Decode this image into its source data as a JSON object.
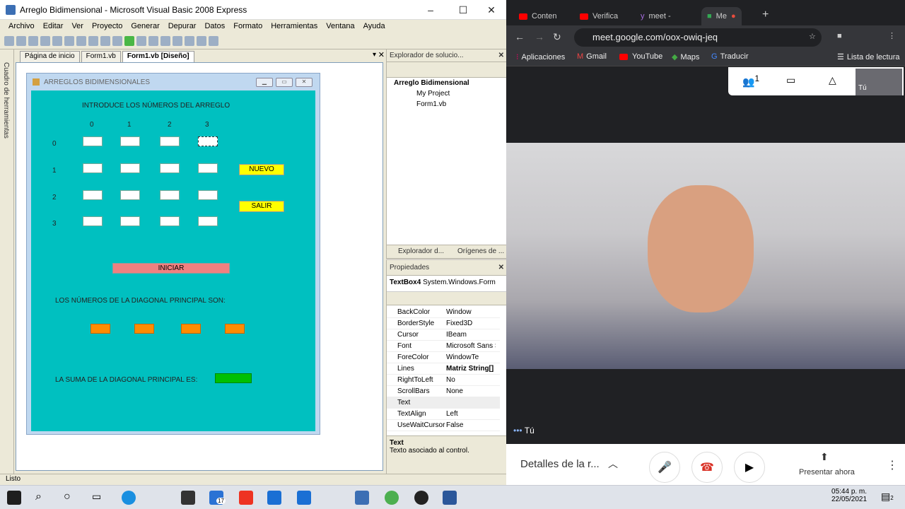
{
  "vb": {
    "window_title": "Arreglo Bidimensional - Microsoft Visual Basic 2008 Express",
    "menu": [
      "Archivo",
      "Editar",
      "Ver",
      "Proyecto",
      "Generar",
      "Depurar",
      "Datos",
      "Formato",
      "Herramientas",
      "Ventana",
      "Ayuda"
    ],
    "toolbox_label": "Cuadro de herramientas",
    "tabs": [
      "Página de inicio",
      "Form1.vb",
      "Form1.vb [Diseño]"
    ],
    "status": "Listo"
  },
  "form": {
    "title": "ARREGLOS BIDIMENSIONALES",
    "intro_label": "INTRODUCE LOS NÚMEROS DEL ARREGLO",
    "col_labels": [
      "0",
      "1",
      "2",
      "3"
    ],
    "row_labels": [
      "0",
      "1",
      "2",
      "3"
    ],
    "nuevo_button": "NUEVO",
    "salir_button": "SALIR",
    "iniciar_button": "INICIAR",
    "diagonal_label": "LOS NÚMEROS DE LA DIAGONAL PRINCIPAL SON:",
    "suma_label": "LA SUMA DE LA DIAGONAL PRINCIPAL ES:"
  },
  "solution_explorer": {
    "header": "Explorador de solucio...",
    "items": [
      "Arreglo Bidimensional",
      "My Project",
      "Form1.vb"
    ],
    "bottom_tabs": [
      "Explorador d...",
      "Orígenes de ..."
    ]
  },
  "properties": {
    "header": "Propiedades",
    "object_name": "TextBox4",
    "object_type": "System.Windows.Form",
    "rows": [
      {
        "name": "BackColor",
        "value": "Window"
      },
      {
        "name": "BorderStyle",
        "value": "Fixed3D"
      },
      {
        "name": "Cursor",
        "value": "IBeam"
      },
      {
        "name": "Font",
        "value": "Microsoft Sans S"
      },
      {
        "name": "ForeColor",
        "value": "WindowTe"
      },
      {
        "name": "Lines",
        "value": "Matriz String[]"
      },
      {
        "name": "RightToLeft",
        "value": "No"
      },
      {
        "name": "ScrollBars",
        "value": "None"
      },
      {
        "name": "Text",
        "value": ""
      },
      {
        "name": "TextAlign",
        "value": "Left"
      },
      {
        "name": "UseWaitCursor",
        "value": "False"
      }
    ],
    "desc_title": "Text",
    "desc_text": "Texto asociado al control."
  },
  "chrome": {
    "tabs": [
      "Conten",
      "Verifica",
      "meet -",
      "Me"
    ],
    "url": "meet.google.com/oox-owiq-jeq",
    "bookmarks": [
      "Aplicaciones",
      "Gmail",
      "YouTube",
      "Maps",
      "Traducir"
    ],
    "reading_list": "Lista de lectura",
    "people_count": "1",
    "self_label": "Tú",
    "self_thumb_label": "Tú",
    "details_label": "Detalles de la r...",
    "present_label": "Presentar ahora"
  },
  "taskbar": {
    "time": "05:44 p. m.",
    "date": "22/05/2021",
    "mail_badge": "17",
    "notif_badge": "2"
  },
  "colors": {
    "form_client": "#00c0c0",
    "nuevo_salir": "#ffff00",
    "iniciar": "#f08080",
    "diagonal_boxes": "#ff8c00",
    "suma_box": "#00c000"
  }
}
